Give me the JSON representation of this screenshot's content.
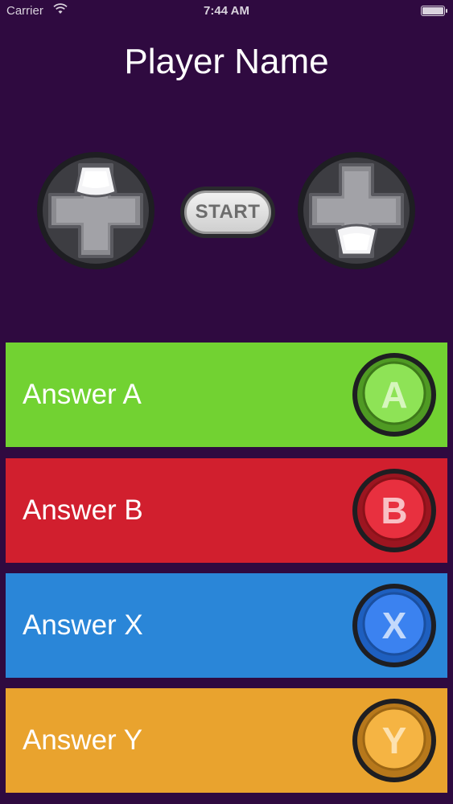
{
  "status_bar": {
    "carrier": "Carrier",
    "time": "7:44 AM",
    "wifi_icon": "wifi-icon",
    "battery_icon": "battery-icon"
  },
  "header": {
    "title": "Player Name"
  },
  "controls": {
    "start_label": "START",
    "left_dpad": {
      "icon": "dpad-up-icon",
      "pressed": "up"
    },
    "right_dpad": {
      "icon": "dpad-down-icon",
      "pressed": "down"
    }
  },
  "answers": [
    {
      "label": "Answer A",
      "button": "A",
      "color": "#72d232"
    },
    {
      "label": "Answer B",
      "button": "B",
      "color": "#d11f2e"
    },
    {
      "label": "Answer X",
      "button": "X",
      "color": "#2a86d8"
    },
    {
      "label": "Answer Y",
      "button": "Y",
      "color": "#e9a32e"
    }
  ],
  "colors": {
    "background": "#2f0a40"
  }
}
